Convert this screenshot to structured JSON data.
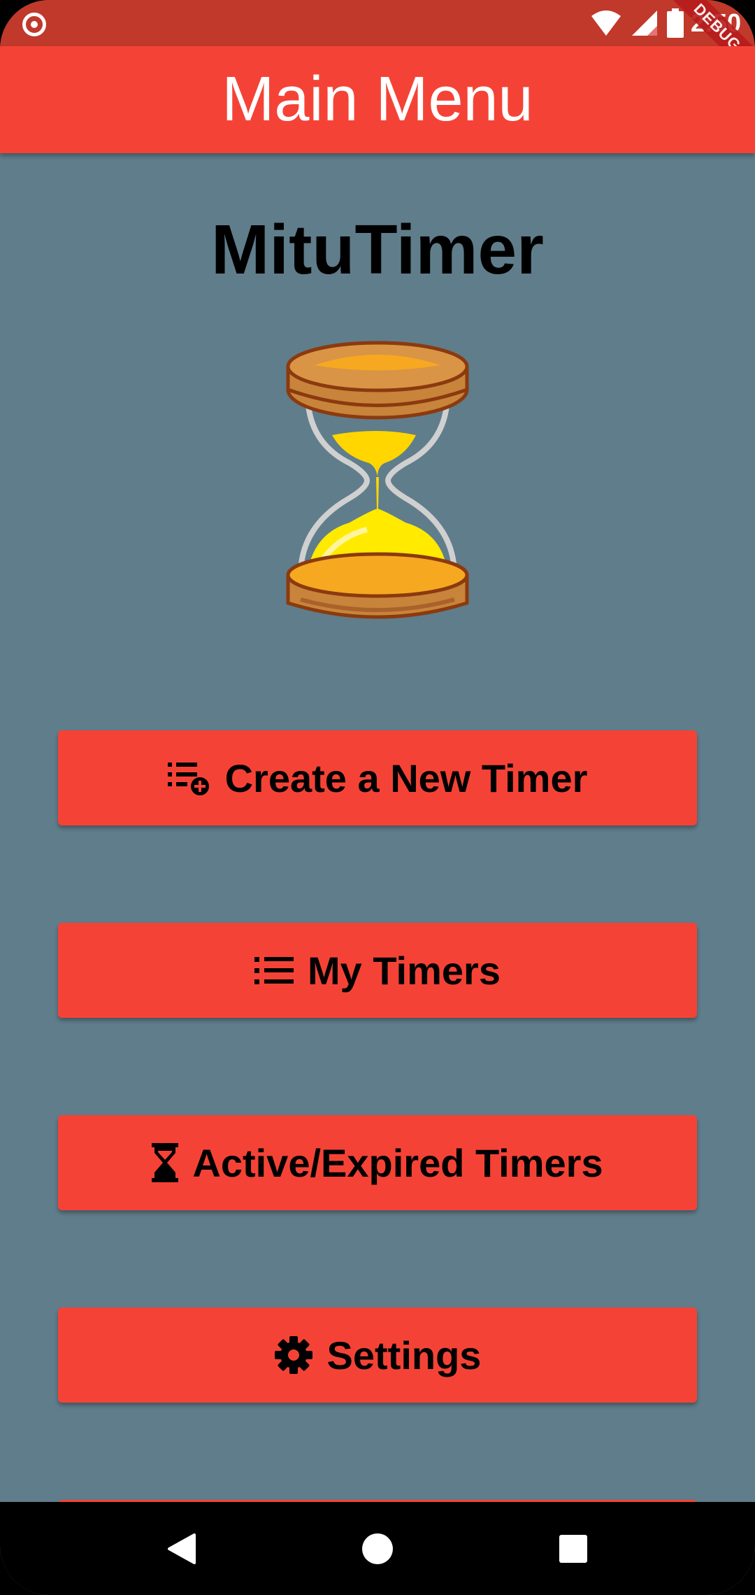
{
  "status_bar": {
    "time": "2:50",
    "debug_label": "DEBUG",
    "icons": [
      "record-icon",
      "wifi-icon",
      "signal-icon",
      "battery-icon"
    ]
  },
  "app_bar": {
    "title": "Main Menu"
  },
  "main": {
    "app_name": "MituTimer",
    "logo_icon": "hourglass-icon",
    "buttons": [
      {
        "label": "Create a New Timer",
        "icon": "playlist-add-icon"
      },
      {
        "label": "My Timers",
        "icon": "list-icon"
      },
      {
        "label": "Active/Expired Timers",
        "icon": "hourglass-icon"
      },
      {
        "label": "Settings",
        "icon": "gear-icon"
      }
    ]
  },
  "nav_bar": {
    "icons": [
      "back-icon",
      "home-icon",
      "recents-icon"
    ]
  },
  "colors": {
    "app_bar": "#f44336",
    "status_bar": "#c0392b",
    "background": "#607d8b",
    "button": "#f44336"
  }
}
